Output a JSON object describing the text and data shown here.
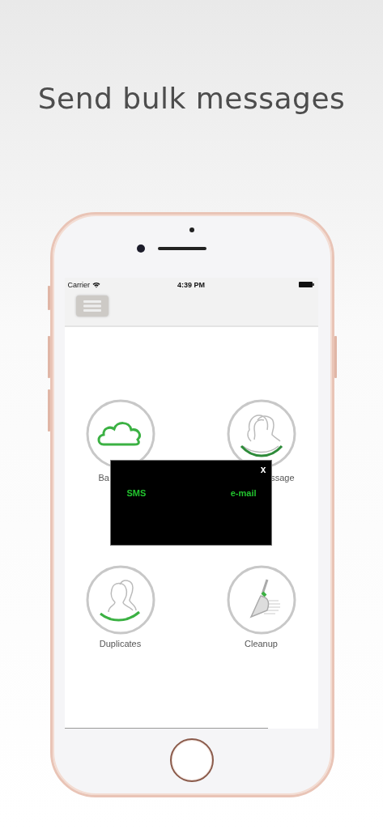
{
  "title": "Send bulk messages",
  "status_bar": {
    "carrier": "Carrier",
    "time": "4:39 PM"
  },
  "tiles": [
    {
      "label": "Ba",
      "kind": "cloud",
      "covered": true
    },
    {
      "label": "ssage",
      "kind": "people",
      "covered": true
    },
    {
      "label": "Duplicates",
      "kind": "pair",
      "covered": false
    },
    {
      "label": "Cleanup",
      "kind": "broom",
      "covered": false
    }
  ],
  "popup": {
    "close": "x",
    "options": [
      "SMS",
      "e-mail"
    ]
  }
}
